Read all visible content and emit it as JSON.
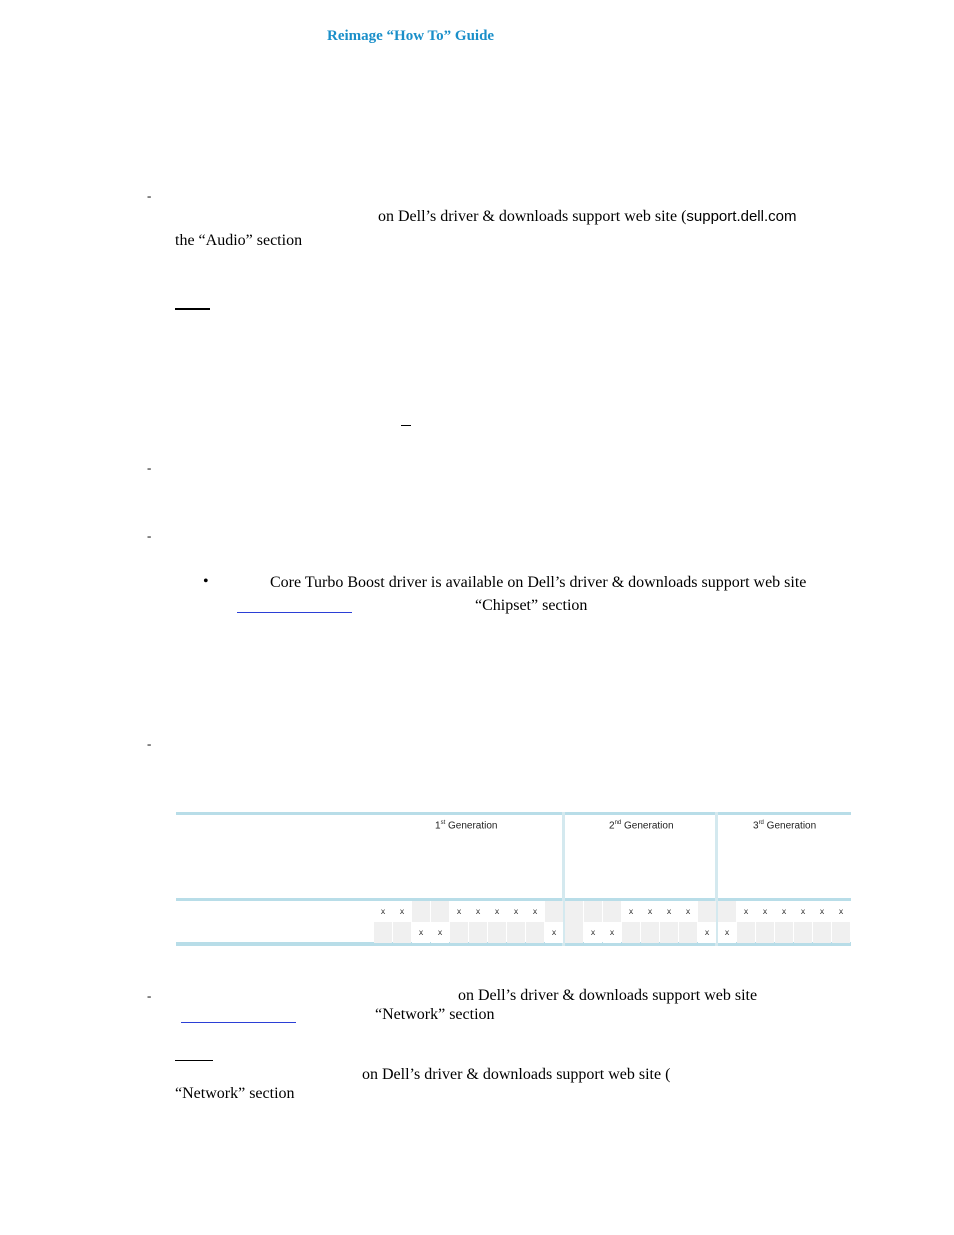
{
  "header": {
    "title": "Reimage “How To” Guide"
  },
  "audio": {
    "dash": "-",
    "line1": "on Dell’s driver & downloads support web site (",
    "site": "support.dell.com",
    "line2": "the “Audio” section"
  },
  "dash_marks": [
    "-",
    "-",
    "-"
  ],
  "turbo": {
    "bullet": "•",
    "line1": "Core Turbo Boost driver is available on Dell’s driver & downloads support web site",
    "line2": "“Chipset” section"
  },
  "table": {
    "generations": [
      {
        "num": "1",
        "sup": "st",
        "label": " Generation"
      },
      {
        "num": "2",
        "sup": "nd",
        "label": " Generation"
      },
      {
        "num": "3",
        "sup": "rd",
        "label": " Generation"
      }
    ],
    "mark": "x",
    "rows": [
      [
        [
          "x",
          "x",
          "",
          "",
          "x",
          "x",
          "x",
          "x",
          "x",
          ""
        ],
        [
          "",
          "",
          "",
          "x",
          "x",
          "x",
          "x",
          ""
        ],
        [
          "",
          "x",
          "x",
          "x",
          "x",
          "x",
          "x"
        ]
      ],
      [
        [
          "",
          "",
          "x",
          "x",
          "",
          "",
          "",
          "",
          "",
          "x"
        ],
        [
          "",
          "x",
          "x",
          "",
          "",
          "",
          "",
          "x"
        ],
        [
          "x",
          "",
          "",
          "",
          "",
          "",
          ""
        ]
      ]
    ]
  },
  "network": {
    "dash": "-",
    "line1": "on Dell’s driver & downloads support web site",
    "line2": "“Network” section",
    "line3": "on Dell’s driver & downloads support web site (",
    "line4": "“Network” section"
  }
}
